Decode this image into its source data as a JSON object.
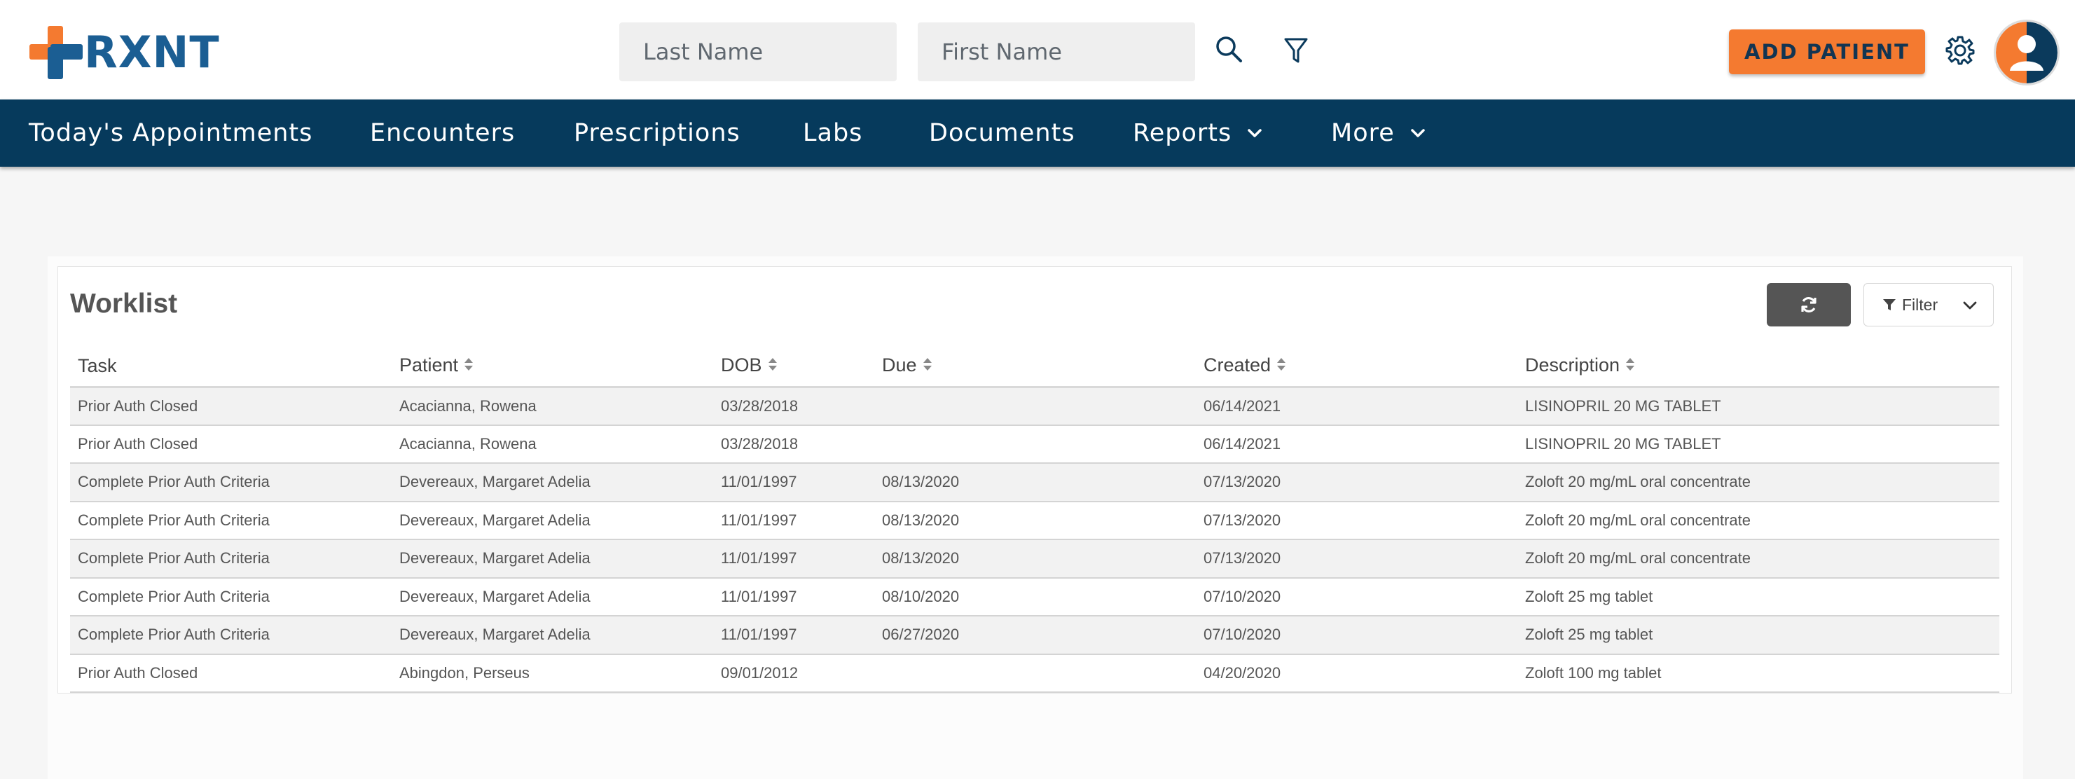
{
  "app": {
    "logo_text": "RXNT"
  },
  "search": {
    "last_name_placeholder": "Last Name",
    "first_name_placeholder": "First Name"
  },
  "header": {
    "add_patient_label": "ADD PATIENT",
    "accent_color": "#f47a30",
    "brand_color": "#1b5e93"
  },
  "nav": {
    "items": [
      {
        "label": "Today's Appointments"
      },
      {
        "label": "Encounters"
      },
      {
        "label": "Prescriptions"
      },
      {
        "label": "Labs"
      },
      {
        "label": "Documents"
      },
      {
        "label": "Reports",
        "has_dropdown": true
      },
      {
        "label": "More",
        "has_dropdown": true
      }
    ],
    "background": "#063a5c"
  },
  "worklist": {
    "title": "Worklist",
    "filter_label": "Filter",
    "columns": [
      {
        "label": "Task",
        "sortable": false
      },
      {
        "label": "Patient",
        "sortable": true
      },
      {
        "label": "DOB",
        "sortable": true
      },
      {
        "label": "Due",
        "sortable": true
      },
      {
        "label": "Created",
        "sortable": true
      },
      {
        "label": "Description",
        "sortable": true
      }
    ],
    "rows": [
      {
        "task": "Prior Auth Closed",
        "patient": "Acacianna, Rowena",
        "dob": "03/28/2018",
        "due": "",
        "created": "06/14/2021",
        "description": "LISINOPRIL 20 MG TABLET"
      },
      {
        "task": "Prior Auth Closed",
        "patient": "Acacianna, Rowena",
        "dob": "03/28/2018",
        "due": "",
        "created": "06/14/2021",
        "description": "LISINOPRIL 20 MG TABLET"
      },
      {
        "task": "Complete Prior Auth Criteria",
        "patient": "Devereaux, Margaret Adelia",
        "dob": "11/01/1997",
        "due": "08/13/2020",
        "created": "07/13/2020",
        "description": "Zoloft 20 mg/mL oral concentrate"
      },
      {
        "task": "Complete Prior Auth Criteria",
        "patient": "Devereaux, Margaret Adelia",
        "dob": "11/01/1997",
        "due": "08/13/2020",
        "created": "07/13/2020",
        "description": "Zoloft 20 mg/mL oral concentrate"
      },
      {
        "task": "Complete Prior Auth Criteria",
        "patient": "Devereaux, Margaret Adelia",
        "dob": "11/01/1997",
        "due": "08/13/2020",
        "created": "07/13/2020",
        "description": "Zoloft 20 mg/mL oral concentrate"
      },
      {
        "task": "Complete Prior Auth Criteria",
        "patient": "Devereaux, Margaret Adelia",
        "dob": "11/01/1997",
        "due": "08/10/2020",
        "created": "07/10/2020",
        "description": "Zoloft 25 mg tablet"
      },
      {
        "task": "Complete Prior Auth Criteria",
        "patient": "Devereaux, Margaret Adelia",
        "dob": "11/01/1997",
        "due": "06/27/2020",
        "created": "07/10/2020",
        "description": "Zoloft 25 mg tablet"
      },
      {
        "task": "Prior Auth Closed",
        "patient": "Abingdon, Perseus",
        "dob": "09/01/2012",
        "due": "",
        "created": "04/20/2020",
        "description": "Zoloft 100 mg tablet"
      }
    ]
  },
  "icons": {
    "logo": "cross-logo-icon",
    "search": "search-icon",
    "filter": "funnel-icon",
    "settings": "gear-icon",
    "avatar": "user-avatar-icon",
    "refresh": "refresh-icon",
    "dropdown": "chevron-down-icon",
    "sort": "sort-icon"
  }
}
